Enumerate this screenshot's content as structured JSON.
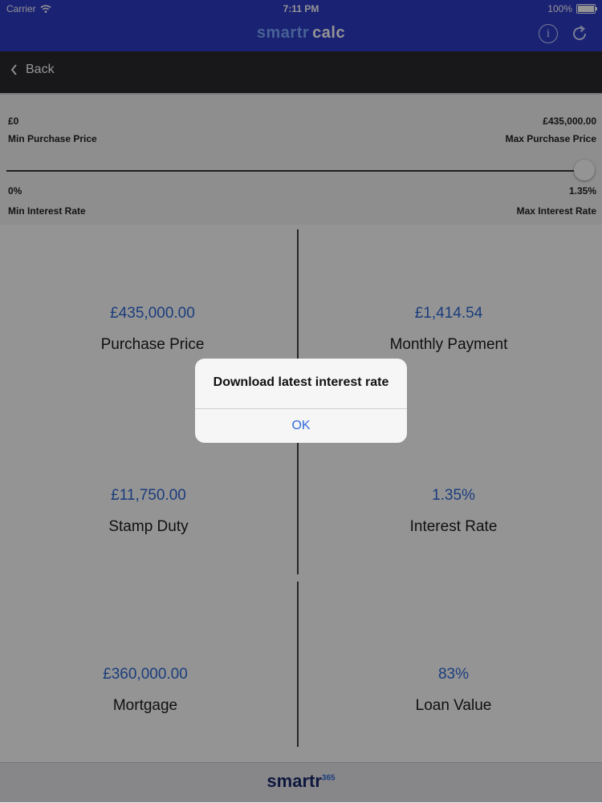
{
  "status_bar": {
    "carrier": "Carrier",
    "time": "7:11 PM",
    "battery": "100%"
  },
  "nav_bar": {
    "logo_part1": "smartr",
    "logo_part2": "calc"
  },
  "toolbar": {
    "back_label": "Back"
  },
  "range_panel": {
    "min_price_value": "£0",
    "min_price_label": "Min Purchase Price",
    "max_price_value": "£435,000.00",
    "max_price_label": "Max Purchase Price",
    "min_rate_value": "0%",
    "min_rate_label": "Min Interest Rate",
    "max_rate_value": "1.35%",
    "max_rate_label": "Max Interest Rate",
    "slider_level": 1.0
  },
  "results": [
    {
      "value": "£435,000.00",
      "label": "Purchase Price"
    },
    {
      "value": "£1,414.54",
      "label": "Monthly Payment"
    },
    {
      "value": "£11,750.00",
      "label": "Stamp Duty"
    },
    {
      "value": "1.35%",
      "label": "Interest Rate"
    },
    {
      "value": "£360,000.00",
      "label": "Mortgage"
    },
    {
      "value": "83%",
      "label": "Loan Value"
    }
  ],
  "footer": {
    "brand": "smartr",
    "brand_sup": "365"
  },
  "alert": {
    "title": "Download latest interest rate",
    "ok_label": "OK"
  },
  "colors": {
    "nav_bar": "#2e3cc8",
    "toolbar": "#2a2a2e",
    "accent_value": "#2f69d8"
  },
  "icons": [
    "wifi-icon",
    "battery-icon",
    "info-icon",
    "refresh-icon",
    "back-chevron-icon"
  ]
}
